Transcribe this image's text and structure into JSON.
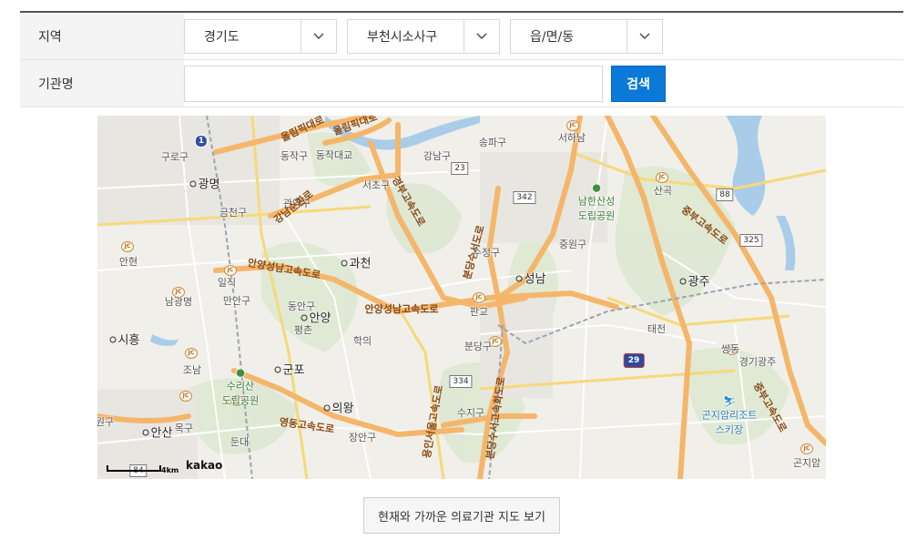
{
  "form": {
    "region_label": "지역",
    "org_label": "기관명",
    "selects": [
      {
        "value": "경기도",
        "arrow_icon": "chevron-down-icon"
      },
      {
        "value": "부천시소사구",
        "arrow_icon": "chevron-down-icon"
      },
      {
        "value": "읍/면/동",
        "arrow_icon": "chevron-down-icon"
      }
    ],
    "org_input": {
      "value": "",
      "placeholder": ""
    },
    "search_button": "검색"
  },
  "map": {
    "provider": "kakao",
    "scale_label": "4km",
    "cities": [
      {
        "name": "광명"
      },
      {
        "name": "과천"
      },
      {
        "name": "성남"
      },
      {
        "name": "광주"
      },
      {
        "name": "안양"
      },
      {
        "name": "시흥"
      },
      {
        "name": "군포"
      },
      {
        "name": "의왕"
      },
      {
        "name": "안산"
      }
    ],
    "districts": [
      "구로구",
      "동작구",
      "동작대교",
      "강남구",
      "송파구",
      "서하남",
      "서초구",
      "관악구",
      "금천구",
      "안현",
      "일직",
      "만안구",
      "남광명",
      "동안구",
      "평촌",
      "학의",
      "판교",
      "분당구",
      "조남",
      "수지구",
      "장안구",
      "둔대",
      "태전",
      "쌍동",
      "경기광주",
      "곤지암",
      "산곡",
      "중원구",
      "수정구",
      "원구",
      "목구"
    ],
    "roads": [
      "올림픽대로",
      "올림픽대로",
      "강남순환로",
      "경부고속도로",
      "분당수서도로",
      "안양성남고속도로",
      "안양성남고속도로",
      "영동고속도로",
      "용인서울고속도로",
      "분당수서고속화도로",
      "중부고속도로",
      "중부고속도로"
    ],
    "shields": [
      "1",
      "23",
      "342",
      "88",
      "325",
      "29",
      "334",
      "84"
    ],
    "parks": [
      {
        "name": "남한산성\n도립공원"
      },
      {
        "name": "수리산\n도립공원"
      }
    ],
    "resort": "곤지암리조트\n스키장"
  },
  "bottom_button": "현재와 가까운 의료기관 지도 보기"
}
